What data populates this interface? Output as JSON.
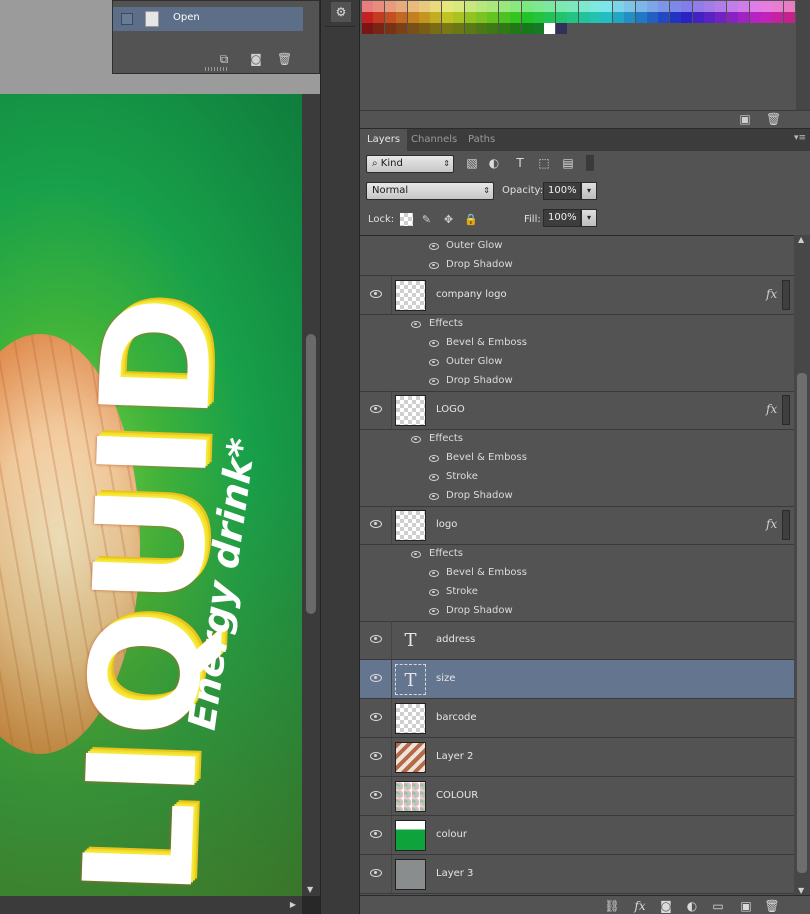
{
  "history": {
    "item_label": "Open"
  },
  "artwork": {
    "main_text": "LIQUID",
    "sub_text": "Energy drink*"
  },
  "layers_panel": {
    "tabs": [
      "Layers",
      "Channels",
      "Paths"
    ],
    "filter_kind": "Kind",
    "blend_mode": "Normal",
    "opacity_label": "Opacity:",
    "opacity_value": "100%",
    "lock_label": "Lock:",
    "fill_label": "Fill:",
    "fill_value": "100%"
  },
  "layers": {
    "top_partial_effects": [
      "Outer Glow",
      "Drop Shadow"
    ],
    "company_logo": {
      "name": "company logo",
      "effects_label": "Effects",
      "effects": [
        "Bevel & Emboss",
        "Outer Glow",
        "Drop Shadow"
      ]
    },
    "LOGO": {
      "name": "LOGO",
      "effects_label": "Effects",
      "effects": [
        "Bevel & Emboss",
        "Stroke",
        "Drop Shadow"
      ]
    },
    "logo": {
      "name": "logo",
      "effects_label": "Effects",
      "effects": [
        "Bevel & Emboss",
        "Stroke",
        "Drop Shadow"
      ]
    },
    "address": {
      "name": "address"
    },
    "size": {
      "name": "size"
    },
    "barcode": {
      "name": "barcode"
    },
    "layer2": {
      "name": "Layer 2"
    },
    "COLOUR": {
      "name": "COLOUR"
    },
    "colour": {
      "name": "colour"
    },
    "layer3": {
      "name": "Layer 3"
    },
    "fx_label": "fx",
    "type_glyph": "T"
  },
  "colors": {
    "selected_row": "#64758f",
    "panel_bg": "#535353",
    "colour_thumb_green": "#0ea33b",
    "layer3_thumb_gray": "#8a8d8e"
  }
}
